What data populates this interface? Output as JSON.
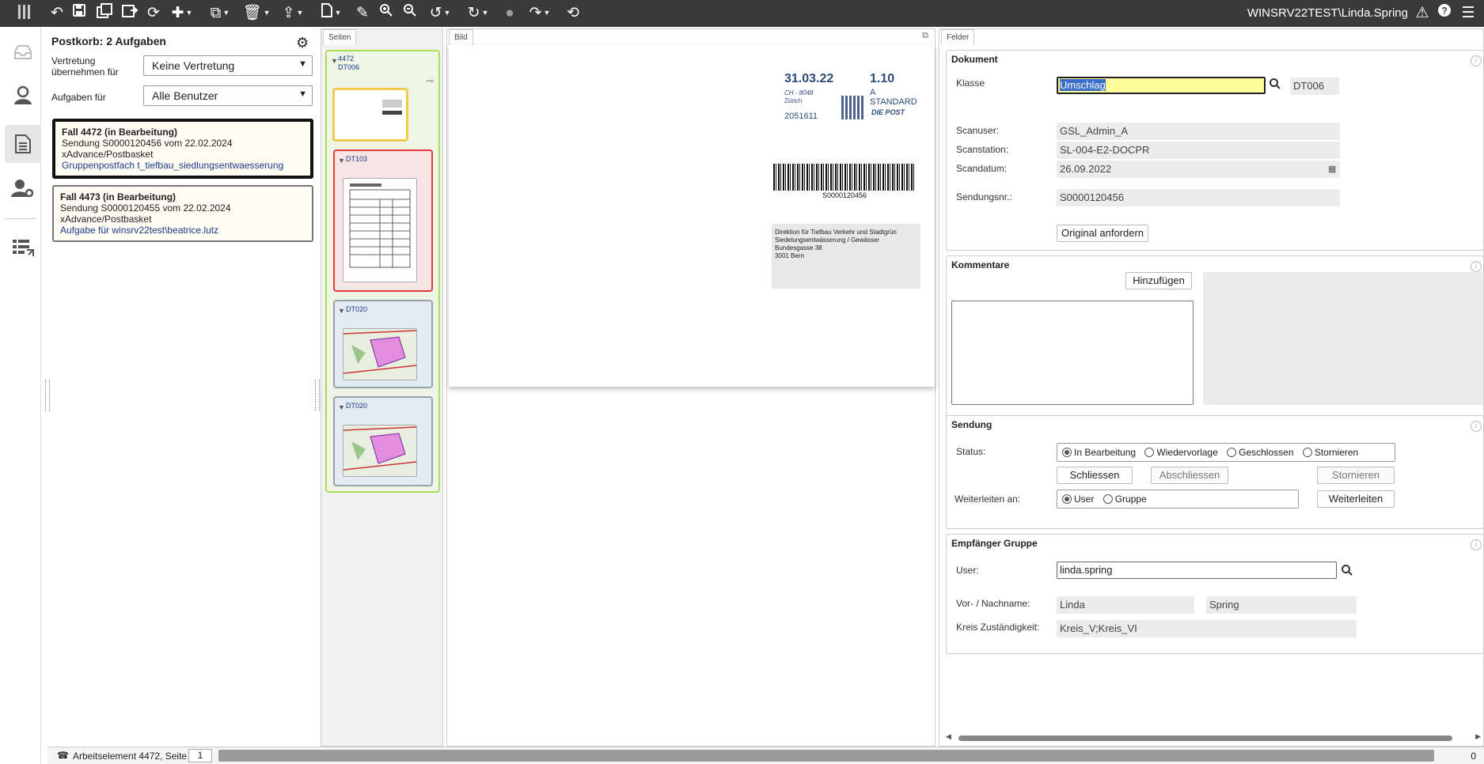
{
  "toolbar": {
    "user": "WINSRV22TEST\\Linda.Spring"
  },
  "postkorb": {
    "title": "Postkorb: 2 Aufgaben",
    "vertretung_label": "Vertretung übernehmen für",
    "vertretung_value": "Keine Vertretung",
    "aufgaben_label": "Aufgaben für",
    "aufgaben_value": "Alle Benutzer",
    "cases": [
      {
        "title": "Fall 4472 (in Bearbeitung)",
        "line1": "Sendung S0000120456 vom 22.02.2024",
        "line2": "xAdvance/Postbasket",
        "link": "Gruppenpostfach t_tiefbau_siedlungsentwaesserung"
      },
      {
        "title": "Fall 4473 (in Bearbeitung)",
        "line1": "Sendung S0000120455 vom 22.02.2024",
        "line2": "xAdvance/Postbasket",
        "link": "Aufgabe für winsrv22test\\beatrice.lutz"
      }
    ]
  },
  "pages": {
    "tab": "Seiten",
    "group_id": "4472",
    "group_doc": "DT006",
    "docs": [
      "DT103",
      "DT020",
      "DT020"
    ]
  },
  "image": {
    "tab": "Bild",
    "stamp_date": "31.03.22",
    "stamp_place": "CH - 8048",
    "stamp_city": "Zürich",
    "stamp_number": "2051611",
    "stamp_price": "1.10",
    "stamp_class": "A",
    "stamp_type": "STANDARD",
    "post_logo": "DIE POST",
    "barcode_text": "S0000120456",
    "address": [
      "Direktion für Tiefbau Verkehr und Stadtgrün",
      "Siedelungsentwässerung / Gewässer",
      "Bundesgasse 38",
      "3001 Bern"
    ]
  },
  "fields": {
    "tab": "Felder",
    "dokument": {
      "title": "Dokument",
      "klasse_label": "Klasse",
      "klasse_value": "Umschlag",
      "klasse_code": "DT006",
      "scanuser_label": "Scanuser:",
      "scanuser_value": "GSL_Admin_A",
      "scanstation_label": "Scanstation:",
      "scanstation_value": "SL-004-E2-DOCPR",
      "scandatum_label": "Scandatum:",
      "scandatum_value": "26.09.2022",
      "sendungsnr_label": "Sendungsnr.:",
      "sendungsnr_value": "S0000120456",
      "original_button": "Original anfordern"
    },
    "kommentare": {
      "title": "Kommentare",
      "add_button": "Hinzufügen"
    },
    "sendung": {
      "title": "Sendung",
      "status_label": "Status:",
      "status_options": [
        "In Bearbeitung",
        "Wiedervorlage",
        "Geschlossen",
        "Stornieren"
      ],
      "btn_schliessen": "Schliessen",
      "btn_abschliessen": "Abschliessen",
      "btn_stornieren": "Stornieren",
      "forward_label": "Weiterleiten an:",
      "forward_options": [
        "User",
        "Gruppe"
      ],
      "btn_weiterleiten": "Weiterleiten"
    },
    "empfaenger": {
      "title": "Empfänger Gruppe",
      "user_label": "User:",
      "user_value": "linda.spring",
      "name_label": "Vor- / Nachname:",
      "first_name": "Linda",
      "last_name": "Spring",
      "kreis_label": "Kreis Zuständigkeit:",
      "kreis_value": "Kreis_V;Kreis_VI"
    }
  },
  "statusbar": {
    "text": "Arbeitselement 4472, Seite",
    "page": "1",
    "count": "0"
  }
}
